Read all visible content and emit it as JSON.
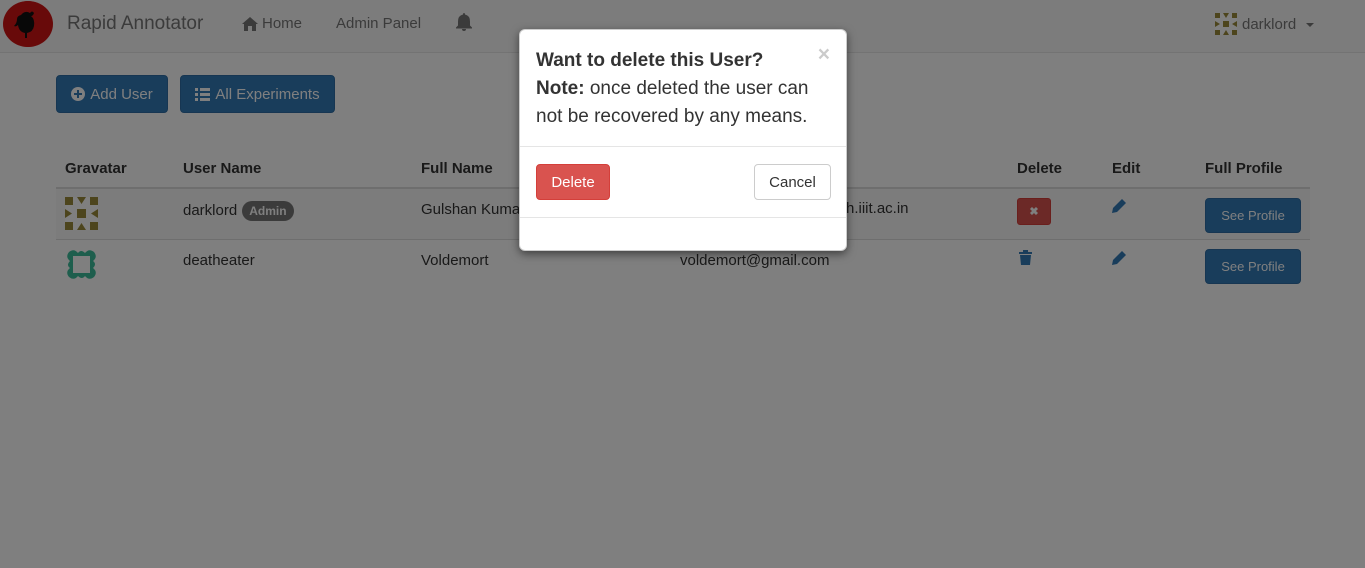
{
  "navbar": {
    "brand": "Rapid Annotator",
    "home_label": "Home",
    "admin_label": "Admin Panel",
    "user_label": "darklord"
  },
  "toolbar": {
    "add_user_label": "Add User",
    "all_experiments_label": "All Experiments"
  },
  "table": {
    "headers": {
      "gravatar": "Gravatar",
      "username": "User Name",
      "fullname": "Full Name",
      "delete": "Delete",
      "edit": "Edit",
      "profile": "Full Profile"
    },
    "rows": [
      {
        "username": "darklord",
        "badge": "Admin",
        "fullname": "Gulshan Kuma",
        "email": "h.iiit.ac.in",
        "profile_label": "See Profile"
      },
      {
        "username": "deatheater",
        "badge": "",
        "fullname": "Voldemort",
        "email": "voldemort@gmail.com",
        "profile_label": "See Profile"
      }
    ]
  },
  "modal": {
    "title": "Want to delete this User?",
    "note_label": "Note:",
    "note_text": " once deleted the user can not be recovered by any means.",
    "close_symbol": "×",
    "delete_label": "Delete",
    "cancel_label": "Cancel"
  },
  "colors": {
    "primary": "#337ab7",
    "danger": "#d9534f",
    "logo": "#d01515"
  }
}
